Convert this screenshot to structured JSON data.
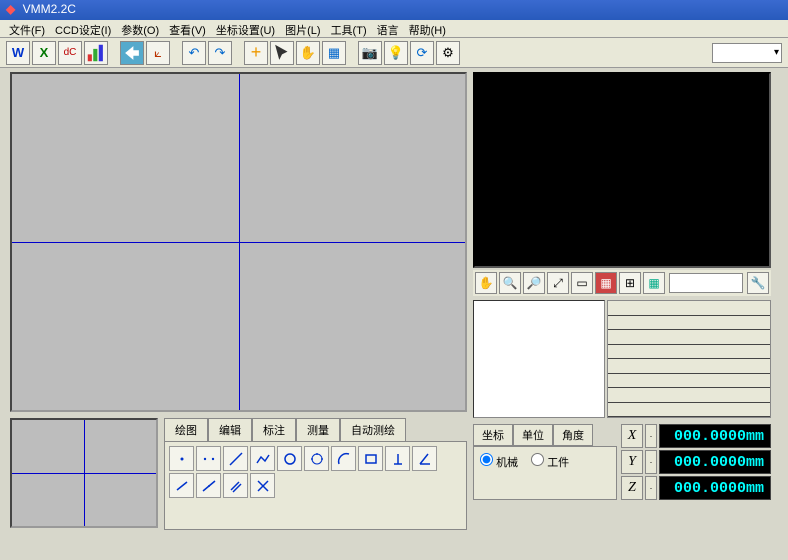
{
  "window": {
    "title": "VMM2.2C"
  },
  "menu": {
    "file": "文件(F)",
    "ccd": "CCD设定(I)",
    "param": "参数(O)",
    "view": "查看(V)",
    "coord": "坐标设置(U)",
    "image": "图片(L)",
    "tool": "工具(T)",
    "lang": "语言",
    "help": "帮助(H)"
  },
  "toolbar_select": "",
  "tabs": {
    "draw": "绘图",
    "edit": "编辑",
    "label": "标注",
    "measure": "测量",
    "auto": "自动测绘"
  },
  "coord_tabs": {
    "coord": "坐标",
    "unit": "单位",
    "angle": "角度"
  },
  "coord_opts": {
    "machine": "机械",
    "work": "工件"
  },
  "axes": {
    "x": "X",
    "y": "Y",
    "z": "Z"
  },
  "dro": {
    "x": "000.0000mm",
    "y": "000.0000mm",
    "z": "000.0000mm"
  },
  "vtool_input": ""
}
